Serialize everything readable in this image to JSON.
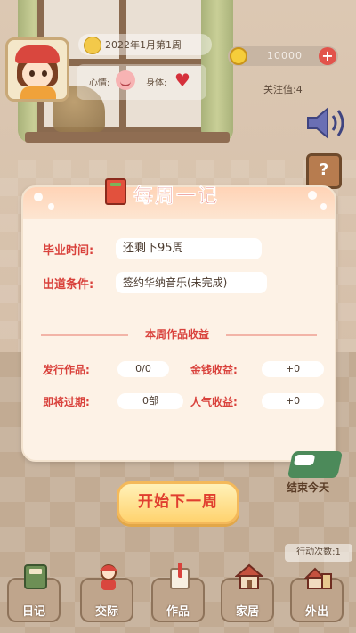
{
  "hud": {
    "date": "2022年1月第1周",
    "mood_label": "心情:",
    "body_label": "身体:",
    "money": "10000",
    "popularity": "关注值:4",
    "icons": [
      "coin-icon",
      "plus-icon",
      "heart-icon",
      "speaker-icon",
      "notebook-icon"
    ]
  },
  "dialog": {
    "title": "每周一记",
    "graduation_label": "毕业时间:",
    "graduation_value": "还剩下95周",
    "debut_label": "出道条件:",
    "debut_value": "签约华纳音乐(未完成)",
    "section_title": "本周作品收益",
    "released_label": "发行作品:",
    "released_value": "0/0",
    "money_income_label": "金钱收益:",
    "money_income_value": "+0",
    "expiring_label": "即将过期:",
    "expiring_value": "0部",
    "popularity_income_label": "人气收益:",
    "popularity_income_value": "+0"
  },
  "next_button": "开始下一周",
  "end_day": "结束今天",
  "actions_count": "行动次数:1",
  "nav": {
    "diary": "日记",
    "social": "交际",
    "works": "作品",
    "home": "家居",
    "outing": "外出"
  },
  "colors": {
    "accent_red": "#d9423c",
    "button_yellow": "#ffd36f",
    "dialog_bg": "#fdf2e6"
  }
}
